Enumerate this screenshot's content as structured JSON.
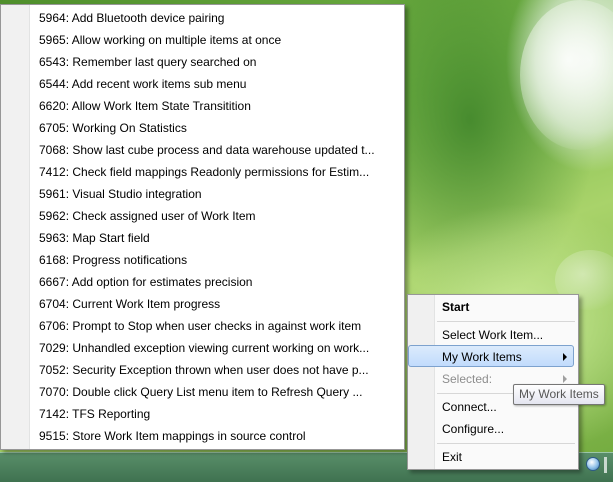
{
  "work_items_menu": {
    "items": [
      "5964: Add Bluetooth device pairing",
      "5965: Allow working on multiple items at once",
      "6543: Remember last query searched on",
      "6544: Add recent work items sub menu",
      "6620: Allow Work Item State Transitition",
      "6705: Working On Statistics",
      "7068: Show last cube process and data warehouse updated t...",
      "7412: Check field mappings Readonly permissions for Estim...",
      "5961: Visual Studio integration",
      "5962: Check assigned user of Work Item",
      "5963: Map Start field",
      "6168: Progress notifications",
      "6667: Add option for estimates precision",
      "6704: Current Work Item progress",
      "6706: Prompt to Stop when user checks in against work item",
      "7029: Unhandled exception viewing current working on work...",
      "7052: Security Exception thrown when user does not have p...",
      "7070: Double click Query List menu item to Refresh Query ...",
      "7142: TFS Reporting",
      "9515: Store Work Item mappings in source control"
    ]
  },
  "tray_menu": {
    "start": "Start",
    "select_work_item": "Select Work Item...",
    "my_work_items": "My Work Items",
    "selected": "Selected:",
    "connect": "Connect...",
    "configure": "Configure...",
    "exit": "Exit"
  },
  "tooltip": {
    "text": "My Work Items"
  },
  "tray": {
    "icon": "work-items-tray-icon"
  }
}
